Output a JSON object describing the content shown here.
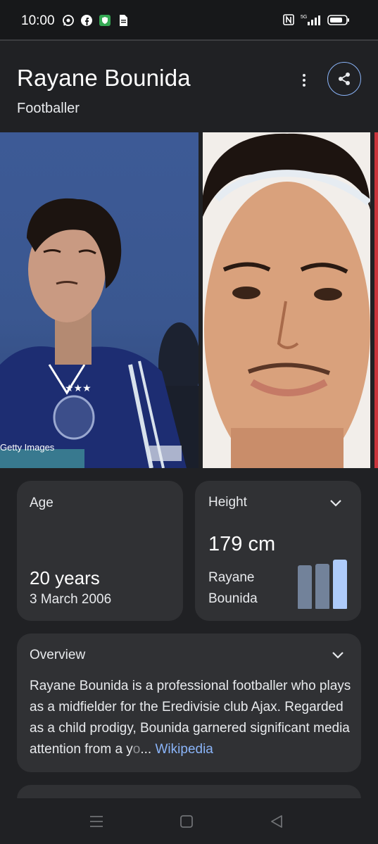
{
  "status_bar": {
    "time": "10:00",
    "left_icons": [
      "whatsapp-icon",
      "facebook-icon",
      "shield-app-icon",
      "document-icon"
    ],
    "right_icons": [
      "nfc-icon",
      "signal-5g-icon",
      "battery-icon"
    ],
    "network_label": "5G"
  },
  "header": {
    "title": "Rayane Bounida",
    "subtitle": "Footballer"
  },
  "images": {
    "credit": "Getty Images"
  },
  "age_card": {
    "label": "Age",
    "value": "20 years",
    "date": "3 March 2006"
  },
  "height_card": {
    "label": "Height",
    "value": "179 cm",
    "name": "Rayane Bounida",
    "bars": [
      0.84,
      0.86,
      0.94
    ],
    "highlight_color": "#aecbfa",
    "bar_color": "#72829a"
  },
  "overview_card": {
    "label": "Overview",
    "text": "Rayane Bounida is a professional footballer who plays as a midfielder for the Eredivisie club Ajax. Regarded as a child prodigy, Bounida garnered significant media attention from a y",
    "faded": "o",
    "ellipsis": "...",
    "link": "Wikipedia"
  },
  "colors": {
    "background": "#202124",
    "card": "#303134",
    "link": "#8ab4f8"
  }
}
